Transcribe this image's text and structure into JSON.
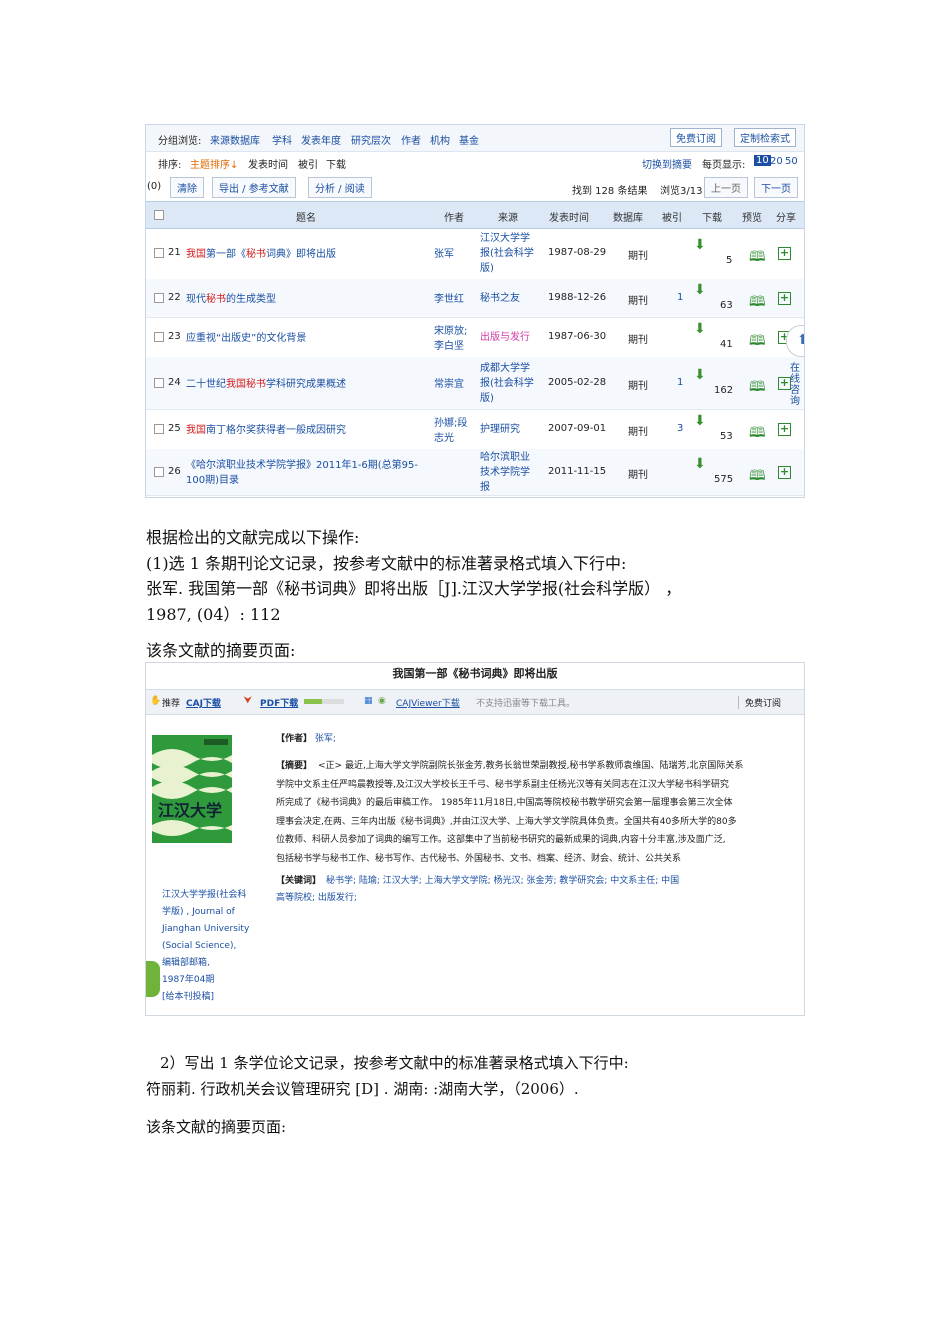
{
  "search_panel": {
    "group_browse_label": "分组浏览:",
    "group_links": [
      "来源数据库",
      "学科",
      "发表年度",
      "研究层次",
      "作者",
      "机构",
      "基金"
    ],
    "free_subscribe": "免费订阅",
    "custom_search": "定制检索式",
    "sort_label": "排序:",
    "sort_options": [
      "主题排序↓",
      "发表时间",
      "被引",
      "下载"
    ],
    "switch_abstract": "切换到摘要",
    "per_page_label": "每页显示:",
    "per_page_options": [
      "10",
      "20",
      "50"
    ],
    "selected_count": "(0)",
    "clear": "清除",
    "export": "导出 / 参考文献",
    "analyze": "分析 / 阅读",
    "result_count": "找到 128 条结果",
    "page_info": "浏览3/13",
    "prev_page": "上一页",
    "next_page": "下一页",
    "headers": [
      "题名",
      "作者",
      "来源",
      "发表时间",
      "数据库",
      "被引",
      "下载",
      "预览",
      "分享"
    ],
    "side_label": "在线咨询",
    "rows": [
      {
        "num": "21",
        "title_pre": "",
        "title_red": "我国",
        "title_mid": "第一部《",
        "title_red2": "秘书",
        "title_post": "词典》即将出版",
        "author": "张军",
        "source": [
          "江汉大学学",
          "报(社会科学",
          "版)"
        ],
        "date": "1987-08-29",
        "db": "期刊",
        "cited": "",
        "downloads": "5"
      },
      {
        "num": "22",
        "title_pre": "现代",
        "title_red": "秘书",
        "title_mid": "的生成类型",
        "title_red2": "",
        "title_post": "",
        "author": "李世红",
        "source": [
          "秘书之友"
        ],
        "date": "1988-12-26",
        "db": "期刊",
        "cited": "1",
        "downloads": "63"
      },
      {
        "num": "23",
        "title_pre": "应重视“出版史”的文化背景",
        "title_red": "",
        "title_mid": "",
        "title_red2": "",
        "title_post": "",
        "author": "宋原放;李白坚",
        "source": [
          "出版与发行"
        ],
        "date": "1987-06-30",
        "db": "期刊",
        "cited": "",
        "downloads": "41"
      },
      {
        "num": "24",
        "title_pre": "二十世纪",
        "title_red": "我国秘书",
        "title_mid": "学科研究成果概述",
        "title_red2": "",
        "title_post": "",
        "author": "常崇宜",
        "source": [
          "成都大学学",
          "报(社会科学",
          "版)"
        ],
        "date": "2005-02-28",
        "db": "期刊",
        "cited": "1",
        "downloads": "162"
      },
      {
        "num": "25",
        "title_pre": "",
        "title_red": "我国",
        "title_mid": "南丁格尔奖获得者一般成因研究",
        "title_red2": "",
        "title_post": "",
        "author": "孙娜;段志光",
        "source": [
          "护理研究"
        ],
        "date": "2007-09-01",
        "db": "期刊",
        "cited": "3",
        "downloads": "53"
      },
      {
        "num": "26",
        "title_pre": "《哈尔滨职业技术学院学报》2011年1-6期(总第95-100期)目录",
        "title_red": "",
        "title_mid": "",
        "title_red2": "",
        "title_post": "",
        "author": "",
        "source": [
          "哈尔滨职业",
          "技术学院学",
          "报"
        ],
        "date": "2011-11-15",
        "db": "期刊",
        "cited": "",
        "downloads": "575"
      }
    ]
  },
  "doc": {
    "intro": "根据检出的文献完成以下操作:",
    "q1": "(1)选 1 条期刊论文记录，按参考文献中的标准著录格式填入下行中:",
    "ref1_line1": "张军.  我国第一部《秘书词典》即将出版［J].江汉大学学报(社会科学版）  ，",
    "ref1_line2": "1987, (04）: 112",
    "abstract_label1": "该条文献的摘要页面:",
    "q2": "2）写出 1 条学位论文记录，按参考文献中的标准著录格式填入下行中:",
    "ref2": "符丽莉. 行政机关会议管理研究 [D] . 湖南: :湖南大学，（2006）.",
    "abstract_label2": "该条文献的摘要页面:"
  },
  "abstract_panel": {
    "title": "我国第一部《秘书词典》即将出版",
    "recommend": "推荐",
    "caj_download": "CAJ下载",
    "pdf_download": "PDF下载",
    "cajviewer": "CAJViewer下载",
    "no_support": "不支持迅雷等下载工具。",
    "free_subscribe": "免费订阅",
    "author_label": "【作者】",
    "author": "张军;",
    "abstract_label": "【摘要】",
    "abstract_lines": [
      "<正> 最近,上海大学文学院副院长张金芳,教务长翁世荣副教授,秘书学系教师袁维国、陆瑞芳,北京国际关系",
      "学院中文系主任严鸣晨教授等,及江汉大学校长王千弓、秘书学系副主任杨光汉等有关同志在江汉大学秘书科学研究",
      "所完成了《秘书词典》的最后审稿工作。 1985年11月18日,中国高等院校秘书教学研究会第一届理事会第三次全体",
      "理事会决定,在两、三年内出版《秘书词典》,并由江汉大学、上海大学文学院具体负责。全国共有40多所大学的80多",
      "位教师、科研人员参加了词典的编写工作。这部集中了当前秘书研究的最新成果的词典,内容十分丰富,涉及面广泛,",
      "包括秘书学与秘书工作、秘书写作、古代秘书、外国秘书、文书、档案、经济、财会、统计、公共关系"
    ],
    "keywords_label": "【关键词】",
    "keywords_line1": "秘书学;  陆瑜;  江汉大学;  上海大学文学院;  杨光汉;  张金芳;  教学研究会;  中文系主任;  中国",
    "keywords_line2": "高等院校;  出版发行;",
    "cover_title": "江汉大学",
    "journal_lines": [
      "江汉大学学报(社会科",
      "学版) , Journal of",
      "Jianghan University",
      "(Social Science),",
      "编辑部邮箱,",
      "1987年04期",
      "[给本刊投稿]"
    ]
  }
}
